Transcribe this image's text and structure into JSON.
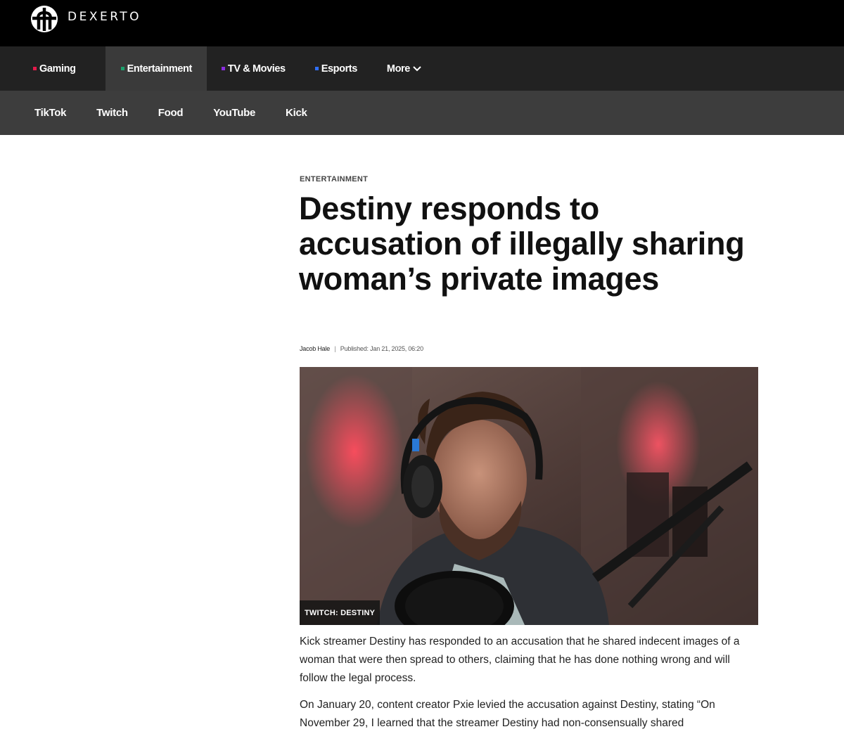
{
  "brand": {
    "name": "DEXERTO",
    "logo_icon": "dexerto-logo-icon"
  },
  "primary_nav": [
    {
      "label": "Gaming",
      "color": "#e5194b",
      "active": false
    },
    {
      "label": "Entertainment",
      "color": "#1ba06b",
      "active": true
    },
    {
      "label": "TV & Movies",
      "color": "#8a2ce0",
      "active": false
    },
    {
      "label": "Esports",
      "color": "#2f6fff",
      "active": false
    },
    {
      "label": "More",
      "color": "",
      "active": false,
      "icon": "chevron-down-icon"
    }
  ],
  "secondary_nav": [
    "TikTok",
    "Twitch",
    "Food",
    "YouTube",
    "Kick"
  ],
  "article": {
    "category": "ENTERTAINMENT",
    "title": "Destiny responds to accusation of illegally sharing woman’s private images",
    "author": "Jacob Hale",
    "separator": "|",
    "published": "Published: Jan 21, 2025, 06:20",
    "image_credit": "TWITCH: DESTINY",
    "paragraphs": [
      "Kick streamer Destiny has responded to an accusation that he shared indecent images of a woman that were then spread to others, claiming that he has done nothing wrong and will follow the legal process.",
      "On January 20, content creator Pxie levied the accusation against Destiny, stating “On November 29, I learned that the streamer Destiny had non-consensually shared"
    ]
  }
}
